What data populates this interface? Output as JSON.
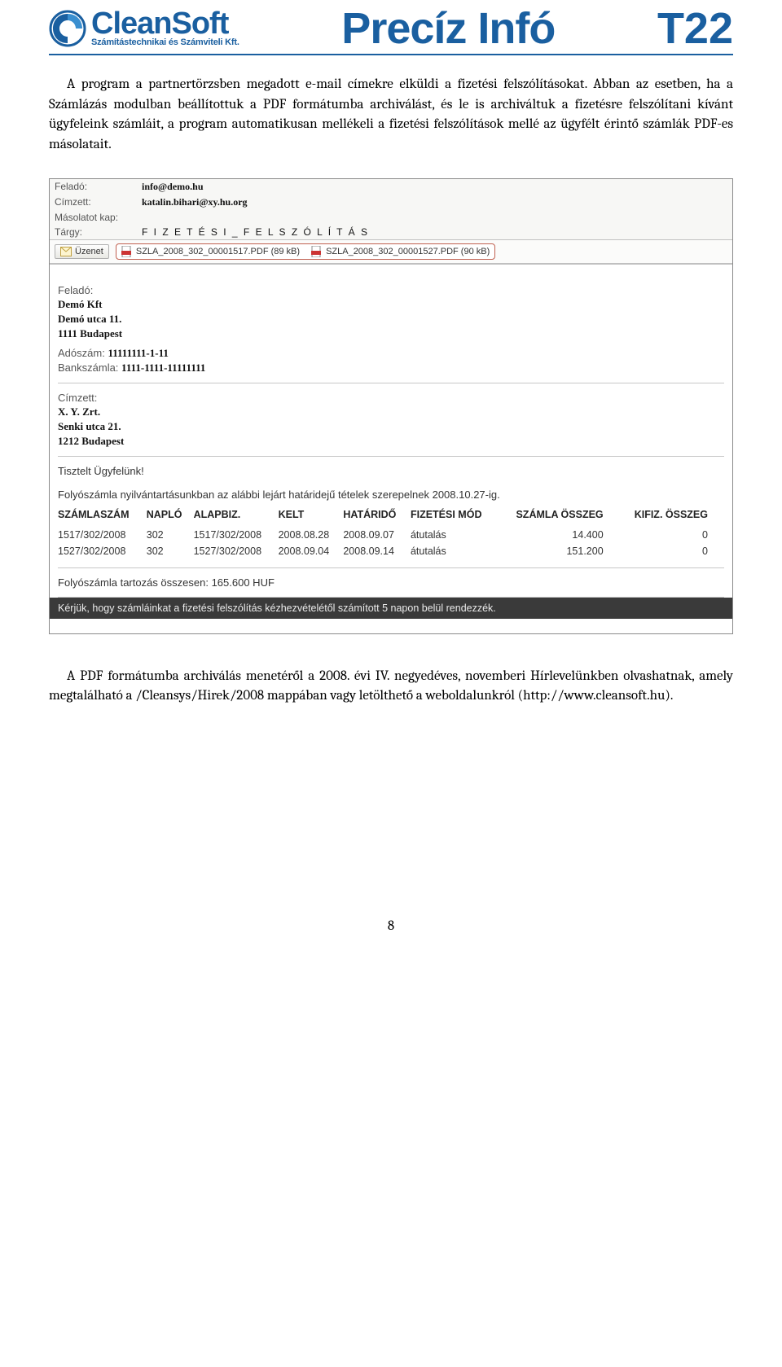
{
  "header": {
    "brand": "CleanSoft",
    "tagline": "Számítástechnikai és Számviteli Kft.",
    "title": "Precíz Infó",
    "code": "T22"
  },
  "para1": "A program a partnertörzsben megadott e-mail címekre elküldi a fizetési felszólításokat. Abban az esetben, ha a Számlázás modulban beállítottuk a PDF formátumba archiválást, és le is archiváltuk a fizetésre felszólítani kívánt ügyfeleink számláit, a program automatikusan mellékeli a fizetési felszólítások mellé az ügyfélt érintő számlák PDF-es másolatait.",
  "email": {
    "fields": {
      "from_lbl": "Feladó:",
      "from_val": "info@demo.hu",
      "to_lbl": "Címzett:",
      "to_val": "katalin.bihari@xy.hu.org",
      "cc_lbl": "Másolatot kap:",
      "cc_val": "",
      "subj_lbl": "Tárgy:",
      "subj_val": "F I Z E T É S I _ F E L S Z Ó L Í T Á S"
    },
    "msg_btn": "Üzenet",
    "attachments": [
      "SZLA_2008_302_00001517.PDF (89 kB)",
      "SZLA_2008_302_00001527.PDF (90 kB)"
    ],
    "body": {
      "sender_lbl": "Feladó:",
      "sender_name": "Demó Kft",
      "sender_addr": "Demó utca 11.",
      "sender_city": "1111 Budapest",
      "tax_lbl": "Adószám:",
      "tax_val": "11111111-1-11",
      "bank_lbl": "Bankszámla:",
      "bank_val": "1111-1111-11111111",
      "rcpt_lbl": "Címzett:",
      "rcpt_name": "X. Y. Zrt.",
      "rcpt_addr": "Senki utca 21.",
      "rcpt_city": "1212 Budapest",
      "greeting": "Tisztelt Ügyfelünk!",
      "intro": "Folyószámla nyilvántartásunkban az alábbi lejárt határidejű tételek szerepelnek 2008.10.27-ig.",
      "cols": {
        "c1": "SZÁMLASZÁM",
        "c2": "NAPLÓ",
        "c3": "ALAPBIZ.",
        "c4": "KELT",
        "c5": "HATÁRIDŐ",
        "c6": "FIZETÉSI MÓD",
        "c7": "SZÁMLA ÖSSZEG",
        "c8": "KIFIZ. ÖSSZEG"
      },
      "rows": [
        {
          "c1": "1517/302/2008",
          "c2": "302",
          "c3": "1517/302/2008",
          "c4": "2008.08.28",
          "c5": "2008.09.07",
          "c6": "átutalás",
          "c7": "14.400",
          "c8": "0"
        },
        {
          "c1": "1527/302/2008",
          "c2": "302",
          "c3": "1527/302/2008",
          "c4": "2008.09.04",
          "c5": "2008.09.14",
          "c6": "átutalás",
          "c7": "151.200",
          "c8": "0"
        }
      ],
      "total": "Folyószámla tartozás összesen: 165.600 HUF",
      "closing": "Kérjük, hogy számláinkat a fizetési felszólítás kézhezvételétől számított 5 napon belül rendezzék."
    }
  },
  "para2": "A PDF formátumba archiválás menetéről a 2008. évi IV. negyedéves, novemberi Hírlevelünkben olvashatnak, amely megtalálható a /Cleansys/Hirek/2008 mappában vagy letölthető a weboldalunkról (http://www.cleansoft.hu).",
  "page_num": "8"
}
